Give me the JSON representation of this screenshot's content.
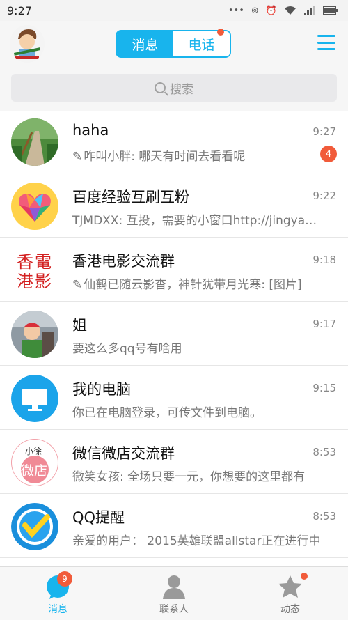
{
  "status_bar": {
    "time": "9:27"
  },
  "header": {
    "tabs": [
      {
        "label": "消息",
        "active": true
      },
      {
        "label": "电话",
        "active": false
      }
    ],
    "phone_tab_has_dot": true
  },
  "search": {
    "placeholder": "搜索"
  },
  "conversations": [
    {
      "title": "haha",
      "time": "9:27",
      "message": "咋叫小胖: 哪天有时间去看看呢",
      "draft": true,
      "unread": "4"
    },
    {
      "title": "百度经验互刷互粉",
      "time": "9:22",
      "message": "TJMDXX: 互投，需要的小窗口http://jingyan.baidu.com"
    },
    {
      "title": "香港电影交流群",
      "time": "9:18",
      "message": "仙鹤已随云影杳，神针犹带月光寒: [图片]",
      "draft": true
    },
    {
      "title": "姐",
      "time": "9:17",
      "message": "要这么多qq号有啥用"
    },
    {
      "title": "我的电脑",
      "time": "9:15",
      "message": "你已在电脑登录，可传文件到电脑。"
    },
    {
      "title": "微信微店交流群",
      "time": "8:53",
      "message": "微笑女孩: 全场只要一元，你想要的这里都有"
    },
    {
      "title": "QQ提醒",
      "time": "8:53",
      "message": "亲爱的用户： 2015英雄联盟allstar正在进行中"
    }
  ],
  "avatars": {
    "hk_chars": [
      "香",
      "電",
      "港",
      "影"
    ],
    "weidian_small": "小徐",
    "weidian_big": "微店"
  },
  "bottom_nav": [
    {
      "label": "消息",
      "badge": "9",
      "active": true
    },
    {
      "label": "联系人"
    },
    {
      "label": "动态",
      "dot": true
    }
  ],
  "colors": {
    "accent": "#18b4ed",
    "badge": "#f15b3a"
  }
}
